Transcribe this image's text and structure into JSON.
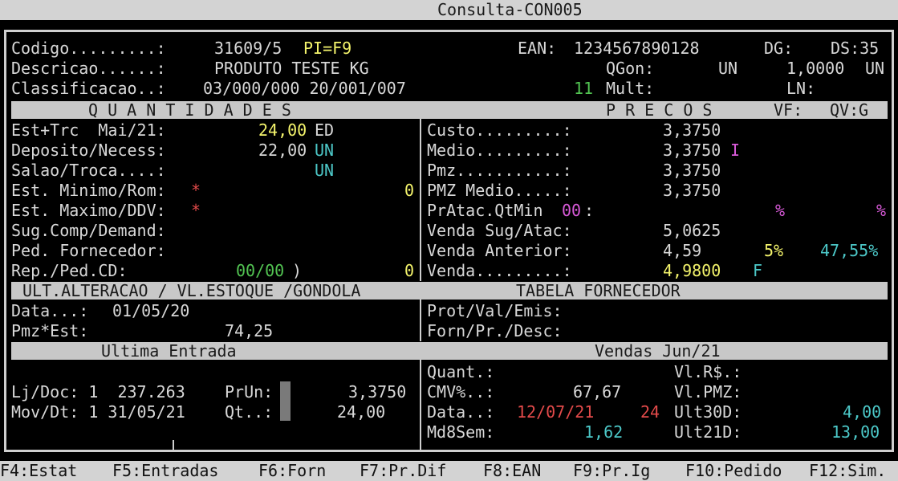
{
  "window": {
    "title": "Consulta-CON005"
  },
  "header": {
    "codigo_label": "Codigo.........:",
    "codigo_value": "31609/5",
    "codigo_pi": "PI=F9",
    "descricao_label": "Descricao......:",
    "descricao_value": "PRODUTO TESTE KG",
    "classif_label": "Classificacao..:",
    "classif_value": "03/000/000 20/001/007",
    "ean_label": "EAN:",
    "ean_value": "1234567890128",
    "dg_label": "DG:",
    "ds_label": "DS:35",
    "qgon_label": "QGon:",
    "qgon_un": "UN",
    "qgon_value": "1,0000",
    "qgon_un2": "UN",
    "mult_num": "11",
    "mult_label": "Mult:",
    "ln_label": "LN:"
  },
  "bands": {
    "quantidades": "Q U A N T I D A D E S",
    "precos": "P R E C O S",
    "vf": "VF:",
    "qv_label": "QV:",
    "qv_value": "G",
    "ult_alteracao": "ULT.ALTERACAO / VL.ESTOQUE /GONDOLA",
    "tabela_fornecedor": "TABELA FORNECEDOR",
    "ultima_entrada": "Ultima Entrada",
    "vendas": "Vendas Jun/21"
  },
  "quantidades": {
    "est_trc_label": "Est+Trc  Mai/21:",
    "est_trc_value": "24,00",
    "est_trc_unit": "ED",
    "deposito_label": "Deposito/Necess:",
    "deposito_value": "22,00",
    "deposito_unit": "UN",
    "salao_label": "Salao/Troca....:",
    "salao_unit": "UN",
    "est_min_label": "Est. Minimo/Rom:",
    "est_min_star": "*",
    "est_min_value": "0",
    "est_max_label": "Est. Maximo/DDV:",
    "est_max_star": "*",
    "sug_label": "Sug.Comp/Demand:",
    "ped_label": "Ped. Fornecedor:",
    "rep_label": "Rep./Ped.CD:",
    "rep_value": "00/00",
    "rep_paren": ")",
    "rep_zero": "0"
  },
  "precos": {
    "custo_label": "Custo.........:",
    "custo_value": "3,3750",
    "medio_label": "Medio.........:",
    "medio_value": "3,3750",
    "medio_flag": "I",
    "pmz_label": "Pmz...........:",
    "pmz_value": "3,3750",
    "pmz_medio_label": "PMZ Medio.....:",
    "pmz_medio_value": "3,3750",
    "pratac_label": "PrAtac.QtMin",
    "pratac_num": "00",
    "pratac_colon": ":",
    "pratac_pct1": "%",
    "pratac_pct2": "%",
    "venda_sug_label": "Venda Sug/Atac:",
    "venda_sug_value": "5,0625",
    "venda_ant_label": "Venda Anterior:",
    "venda_ant_value": "4,59",
    "venda_ant_pct": "5%",
    "venda_ant_margin": "47,55%",
    "venda_label": "Venda.........:",
    "venda_value": "4,9800",
    "venda_flag": "F"
  },
  "ult_alteracao": {
    "data_label": "Data...:",
    "data_value": "01/05/20",
    "pmz_est_label": "Pmz*Est:",
    "pmz_est_value": "74,25"
  },
  "tabela_fornecedor": {
    "prot_label": "Prot/Val/Emis:",
    "forn_label": "Forn/Pr./Desc:"
  },
  "ultima_entrada": {
    "lj_label": "Lj/Doc: 1  237.263",
    "prun_label": "PrUn:",
    "prun_value": "3,3750",
    "mov_label": "Mov/Dt: 1 31/05/21",
    "qt_label": "Qt..:",
    "qt_value": "24,00"
  },
  "vendas": {
    "quant_label": "Quant.:",
    "vlrs_label": "Vl.R$.:",
    "cmv_label": "CMV%..:",
    "cmv_value": "67,67",
    "vlpmz_label": "Vl.PMZ:",
    "data_label": "Data..:",
    "data_value": "12/07/21",
    "data_num": "24",
    "ult30_label": "Ult30D:",
    "ult30_value": "4,00",
    "md8_label": "Md8Sem:",
    "md8_value": "1,62",
    "ult21_label": "Ult21D:",
    "ult21_value": "13,00"
  },
  "function_keys": [
    "F4:Estat",
    "F5:Entradas",
    "F6:Forn",
    "F7:Pr.Dif",
    "F8:EAN",
    "F9:Pr.Ig",
    "F10:Pedido",
    "F12:Sim."
  ]
}
